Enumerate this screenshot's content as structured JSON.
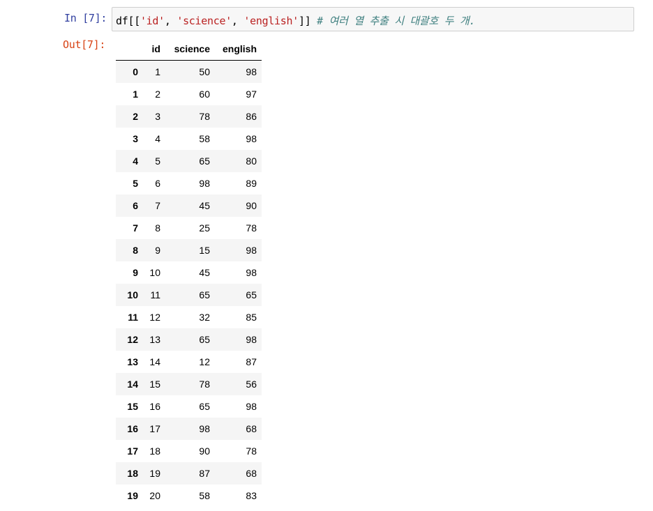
{
  "cell": {
    "in_prompt": "In [7]:",
    "out_prompt": "Out[7]:",
    "code": {
      "prefix": "df[[",
      "str1": "'id'",
      "sep1": ", ",
      "str2": "'science'",
      "sep2": ", ",
      "str3": "'english'",
      "suffix": "]] ",
      "comment": "# 여러 열 추출 시 대괄호 두 개."
    }
  },
  "table": {
    "columns": [
      "",
      "id",
      "science",
      "english"
    ],
    "rows": [
      {
        "index": "0",
        "id": "1",
        "science": "50",
        "english": "98"
      },
      {
        "index": "1",
        "id": "2",
        "science": "60",
        "english": "97"
      },
      {
        "index": "2",
        "id": "3",
        "science": "78",
        "english": "86"
      },
      {
        "index": "3",
        "id": "4",
        "science": "58",
        "english": "98"
      },
      {
        "index": "4",
        "id": "5",
        "science": "65",
        "english": "80"
      },
      {
        "index": "5",
        "id": "6",
        "science": "98",
        "english": "89"
      },
      {
        "index": "6",
        "id": "7",
        "science": "45",
        "english": "90"
      },
      {
        "index": "7",
        "id": "8",
        "science": "25",
        "english": "78"
      },
      {
        "index": "8",
        "id": "9",
        "science": "15",
        "english": "98"
      },
      {
        "index": "9",
        "id": "10",
        "science": "45",
        "english": "98"
      },
      {
        "index": "10",
        "id": "11",
        "science": "65",
        "english": "65"
      },
      {
        "index": "11",
        "id": "12",
        "science": "32",
        "english": "85"
      },
      {
        "index": "12",
        "id": "13",
        "science": "65",
        "english": "98"
      },
      {
        "index": "13",
        "id": "14",
        "science": "12",
        "english": "87"
      },
      {
        "index": "14",
        "id": "15",
        "science": "78",
        "english": "56"
      },
      {
        "index": "15",
        "id": "16",
        "science": "65",
        "english": "98"
      },
      {
        "index": "16",
        "id": "17",
        "science": "98",
        "english": "68"
      },
      {
        "index": "17",
        "id": "18",
        "science": "90",
        "english": "78"
      },
      {
        "index": "18",
        "id": "19",
        "science": "87",
        "english": "68"
      },
      {
        "index": "19",
        "id": "20",
        "science": "58",
        "english": "83"
      }
    ]
  },
  "colors": {
    "in_prompt": "#303f9f",
    "out_prompt": "#d84315",
    "string": "#ba2121",
    "comment": "#408080",
    "input_bg": "#f7f7f7",
    "stripe": "#f5f5f5"
  }
}
